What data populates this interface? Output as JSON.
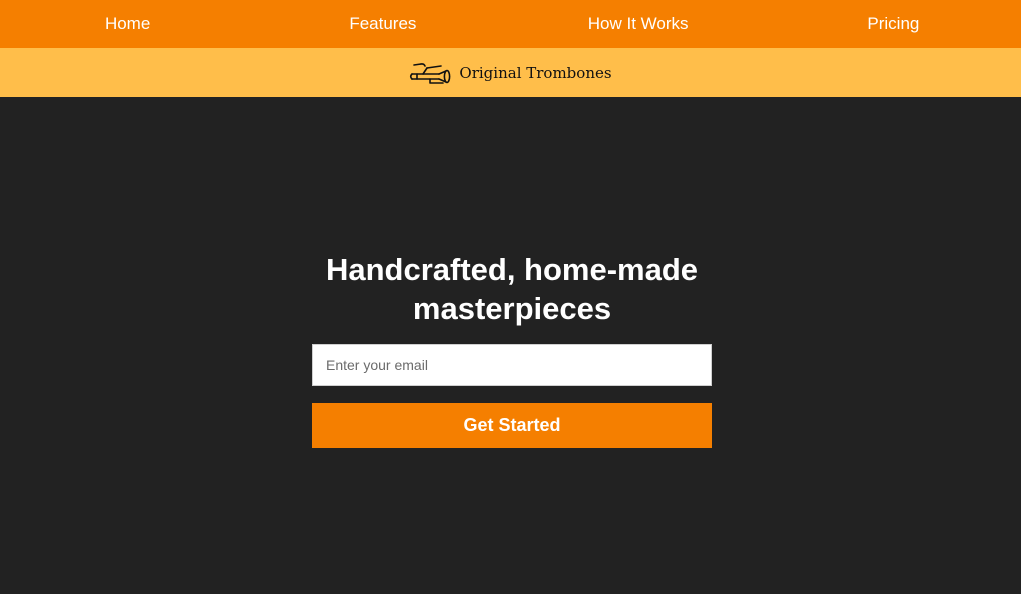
{
  "colors": {
    "nav_background": "#f57f00",
    "brand_bar_background": "#ffbe4a",
    "hero_background": "#222222",
    "accent": "#f57f00",
    "text_light": "#ffffff"
  },
  "nav": {
    "items": [
      {
        "label": "Home"
      },
      {
        "label": "Features"
      },
      {
        "label": "How It Works"
      },
      {
        "label": "Pricing"
      }
    ]
  },
  "brand": {
    "icon": "trombone-icon",
    "name": "Original Trombones"
  },
  "hero": {
    "title": "Handcrafted, home-made masterpieces",
    "email": {
      "value": "",
      "placeholder": "Enter your email"
    },
    "cta_label": "Get Started"
  }
}
